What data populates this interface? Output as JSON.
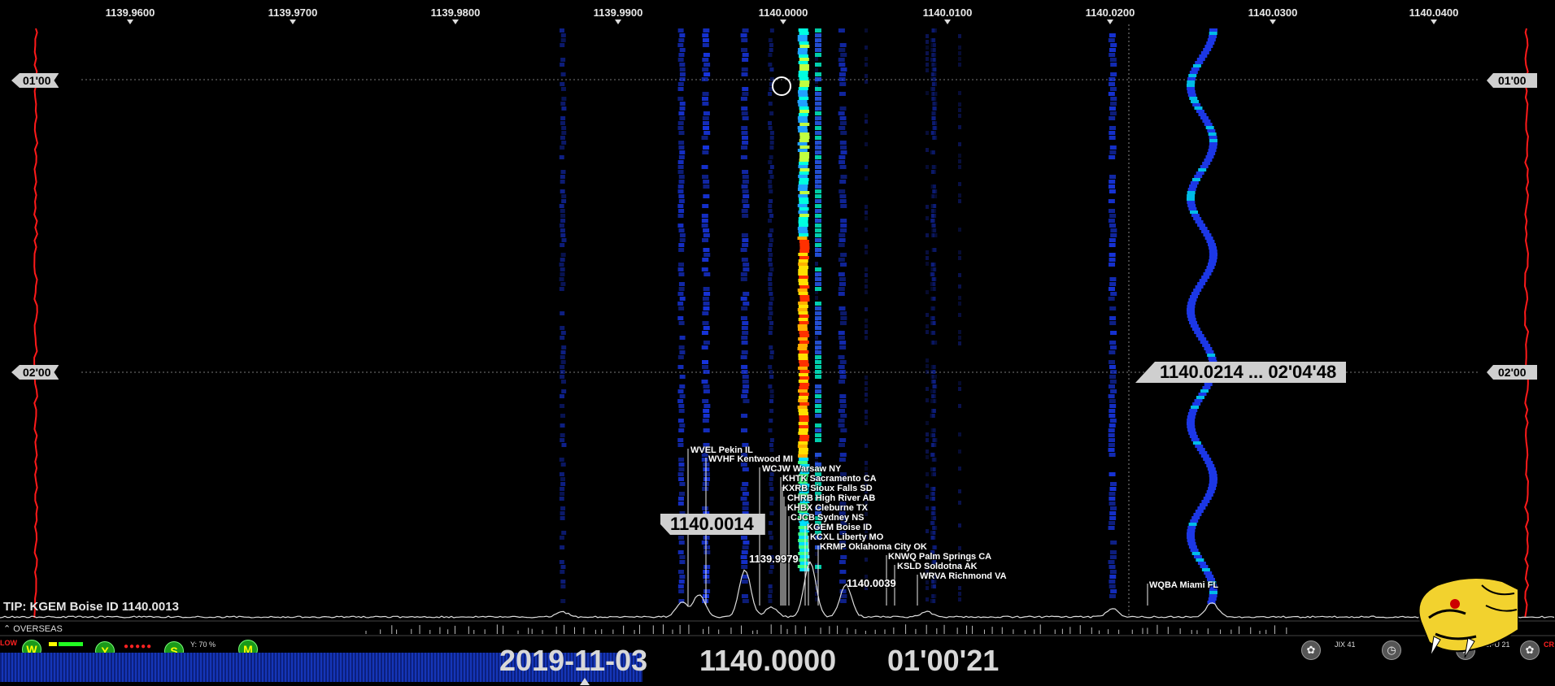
{
  "freq_axis": [
    {
      "label": "1139.9600"
    },
    {
      "label": "1139.9700"
    },
    {
      "label": "1139.9800"
    },
    {
      "label": "1139.9900"
    },
    {
      "label": "1140.0000"
    },
    {
      "label": "1140.0100"
    },
    {
      "label": "1140.0200"
    },
    {
      "label": "1140.0300"
    },
    {
      "label": "1140.0400"
    }
  ],
  "time_markers": [
    {
      "label": "01'00"
    },
    {
      "label": "02'00"
    }
  ],
  "cursor_tag": "1140.0214 ... 02'04'48",
  "peak_tag": "1140.0014",
  "peak_labels": [
    "1139.9979",
    "1140.0039"
  ],
  "stations": [
    {
      "label": "WVEL Pekin IL"
    },
    {
      "label": "WVHF Kentwood MI"
    },
    {
      "label": "WCJW Warsaw NY"
    },
    {
      "label": "KHTK Sacramento CA"
    },
    {
      "label": "KXRB Sioux Falls SD"
    },
    {
      "label": "CHRB High River AB"
    },
    {
      "label": "KHBX Cleburne TX"
    },
    {
      "label": "CJCB Sydney NS"
    },
    {
      "label": "KGEM Boise ID"
    },
    {
      "label": "KCXL Liberty MO"
    },
    {
      "label": "KRMP Oklahoma City OK"
    },
    {
      "label": "KNWQ Palm Springs CA"
    },
    {
      "label": "KSLD Soldotna AK"
    },
    {
      "label": "WRVA Richmond VA"
    },
    {
      "label": "WQBA Miami FL"
    }
  ],
  "tip": "TIP: KGEM Boise ID 1140.0013",
  "overseas": "OVERSEAS",
  "status": {
    "low_label": "LOW",
    "w": "W",
    "y": "Y",
    "s": "S",
    "m": "M",
    "y_percent": "Y: 70 %",
    "date": "2019-11-03",
    "freq": "1140.0000",
    "time": "01'00'21",
    "jix": "JIX 41",
    "cpu": "CPU 21",
    "cr": "CR"
  },
  "colors": {
    "waterfall_blue": "#1a3cff",
    "peak_yellow": "#ffe000",
    "peak_red": "#ff3000",
    "cyan": "#00ffe0",
    "trace_red": "#ff1a1a"
  }
}
